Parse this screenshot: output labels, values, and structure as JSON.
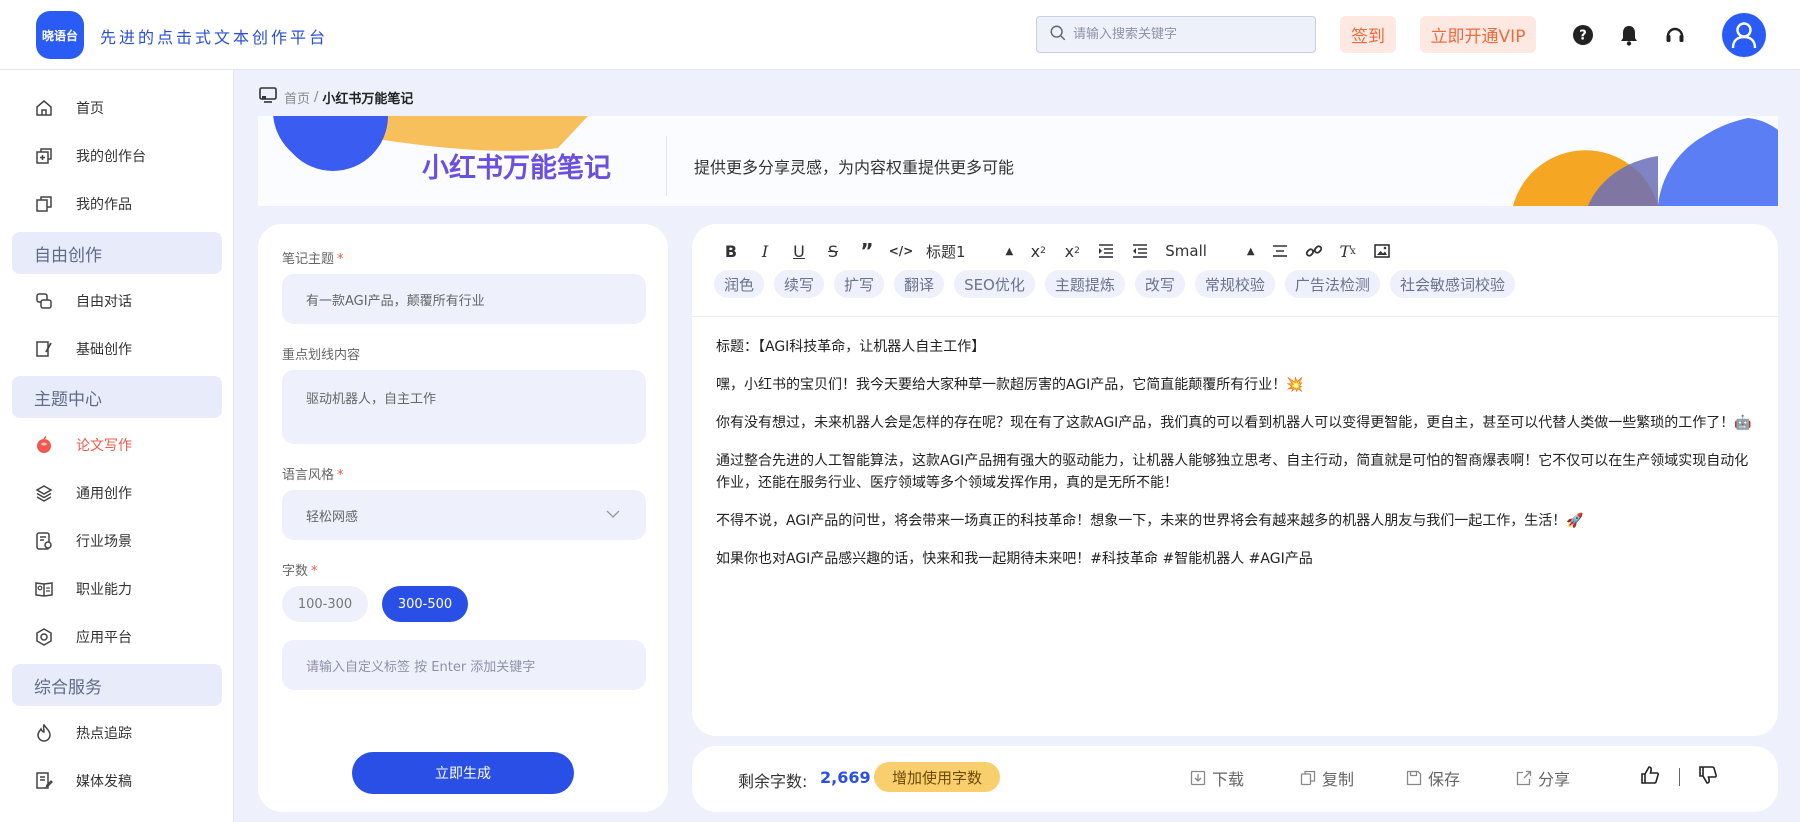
{
  "header": {
    "logo_text": "晓语台",
    "slogan": "先进的点击式文本创作平台",
    "search_placeholder": "请输入搜索关键字",
    "sign_in_label": "签到",
    "vip_label": "立即开通VIP"
  },
  "sidebar": {
    "items_top": [
      {
        "label": "首页",
        "icon": "home-icon"
      },
      {
        "label": "我的创作台",
        "icon": "workbench-icon"
      },
      {
        "label": "我的作品",
        "icon": "works-icon"
      }
    ],
    "section_free": "自由创作",
    "items_free": [
      {
        "label": "自由对话",
        "icon": "chat-icon"
      },
      {
        "label": "基础创作",
        "icon": "edit-icon"
      }
    ],
    "section_topic": "主题中心",
    "items_topic": [
      {
        "label": "论文写作",
        "icon": "paper-icon",
        "active": true
      },
      {
        "label": "通用创作",
        "icon": "layers-icon"
      },
      {
        "label": "行业场景",
        "icon": "scene-icon"
      },
      {
        "label": "职业能力",
        "icon": "career-icon"
      },
      {
        "label": "应用平台",
        "icon": "platform-icon"
      }
    ],
    "section_service": "综合服务",
    "items_service": [
      {
        "label": "热点追踪",
        "icon": "trend-icon"
      },
      {
        "label": "媒体发稿",
        "icon": "media-icon"
      }
    ]
  },
  "breadcrumb": {
    "home": "首页",
    "sep": "/",
    "current": "小红书万能笔记"
  },
  "banner": {
    "title": "小红书万能笔记",
    "description": "提供更多分享灵感，为内容权重提供更多可能"
  },
  "form": {
    "topic_label": "笔记主题",
    "topic_value": "有一款AGI产品，颠覆所有行业",
    "key_label": "重点划线内容",
    "key_value": "驱动机器人，自主工作",
    "style_label": "语言风格",
    "style_value": "轻松网感",
    "count_label": "字数",
    "required_mark": "*",
    "count_options": [
      "100-300",
      "300-500"
    ],
    "count_selected": "300-500",
    "tag_placeholder": "请输入自定义标签 按 Enter 添加关键字",
    "generate_label": "立即生成"
  },
  "editor": {
    "heading_select": "标题1",
    "size_select": "Small",
    "ai_tags": [
      "润色",
      "续写",
      "扩写",
      "翻译",
      "SEO优化",
      "主题提炼",
      "改写",
      "常规校验",
      "广告法检测",
      "社会敏感词校验"
    ],
    "paragraphs": [
      "标题：【AGI科技革命，让机器人自主工作】",
      "嘿，小红书的宝贝们！我今天要给大家种草一款超厉害的AGI产品，它简直能颠覆所有行业！💥",
      "你有没有想过，未来机器人会是怎样的存在呢？现在有了这款AGI产品，我们真的可以看到机器人可以变得更智能，更自主，甚至可以代替人类做一些繁琐的工作了！🤖",
      "通过整合先进的人工智能算法，这款AGI产品拥有强大的驱动能力，让机器人能够独立思考、自主行动，简直就是可怕的智商爆表啊！它不仅可以在生产领域实现自动化作业，还能在服务行业、医疗领域等多个领域发挥作用，真的是无所不能！",
      "不得不说，AGI产品的问世，将会带来一场真正的科技革命！想象一下，未来的世界将会有越来越多的机器人朋友与我们一起工作，生活！🚀",
      "如果你也对AGI产品感兴趣的话，快来和我一起期待未来吧！#科技革命 #智能机器人 #AGI产品"
    ]
  },
  "footer": {
    "remaining_label": "剩余字数:",
    "remaining_value": "2,669",
    "add_words_label": "增加使用字数",
    "download_label": "下载",
    "copy_label": "复制",
    "save_label": "保存",
    "share_label": "分享"
  },
  "colors": {
    "primary": "#2a4fe6",
    "accent_orange": "#f06a3e",
    "active_red": "#f05a4e",
    "background": "#eef1fb"
  }
}
